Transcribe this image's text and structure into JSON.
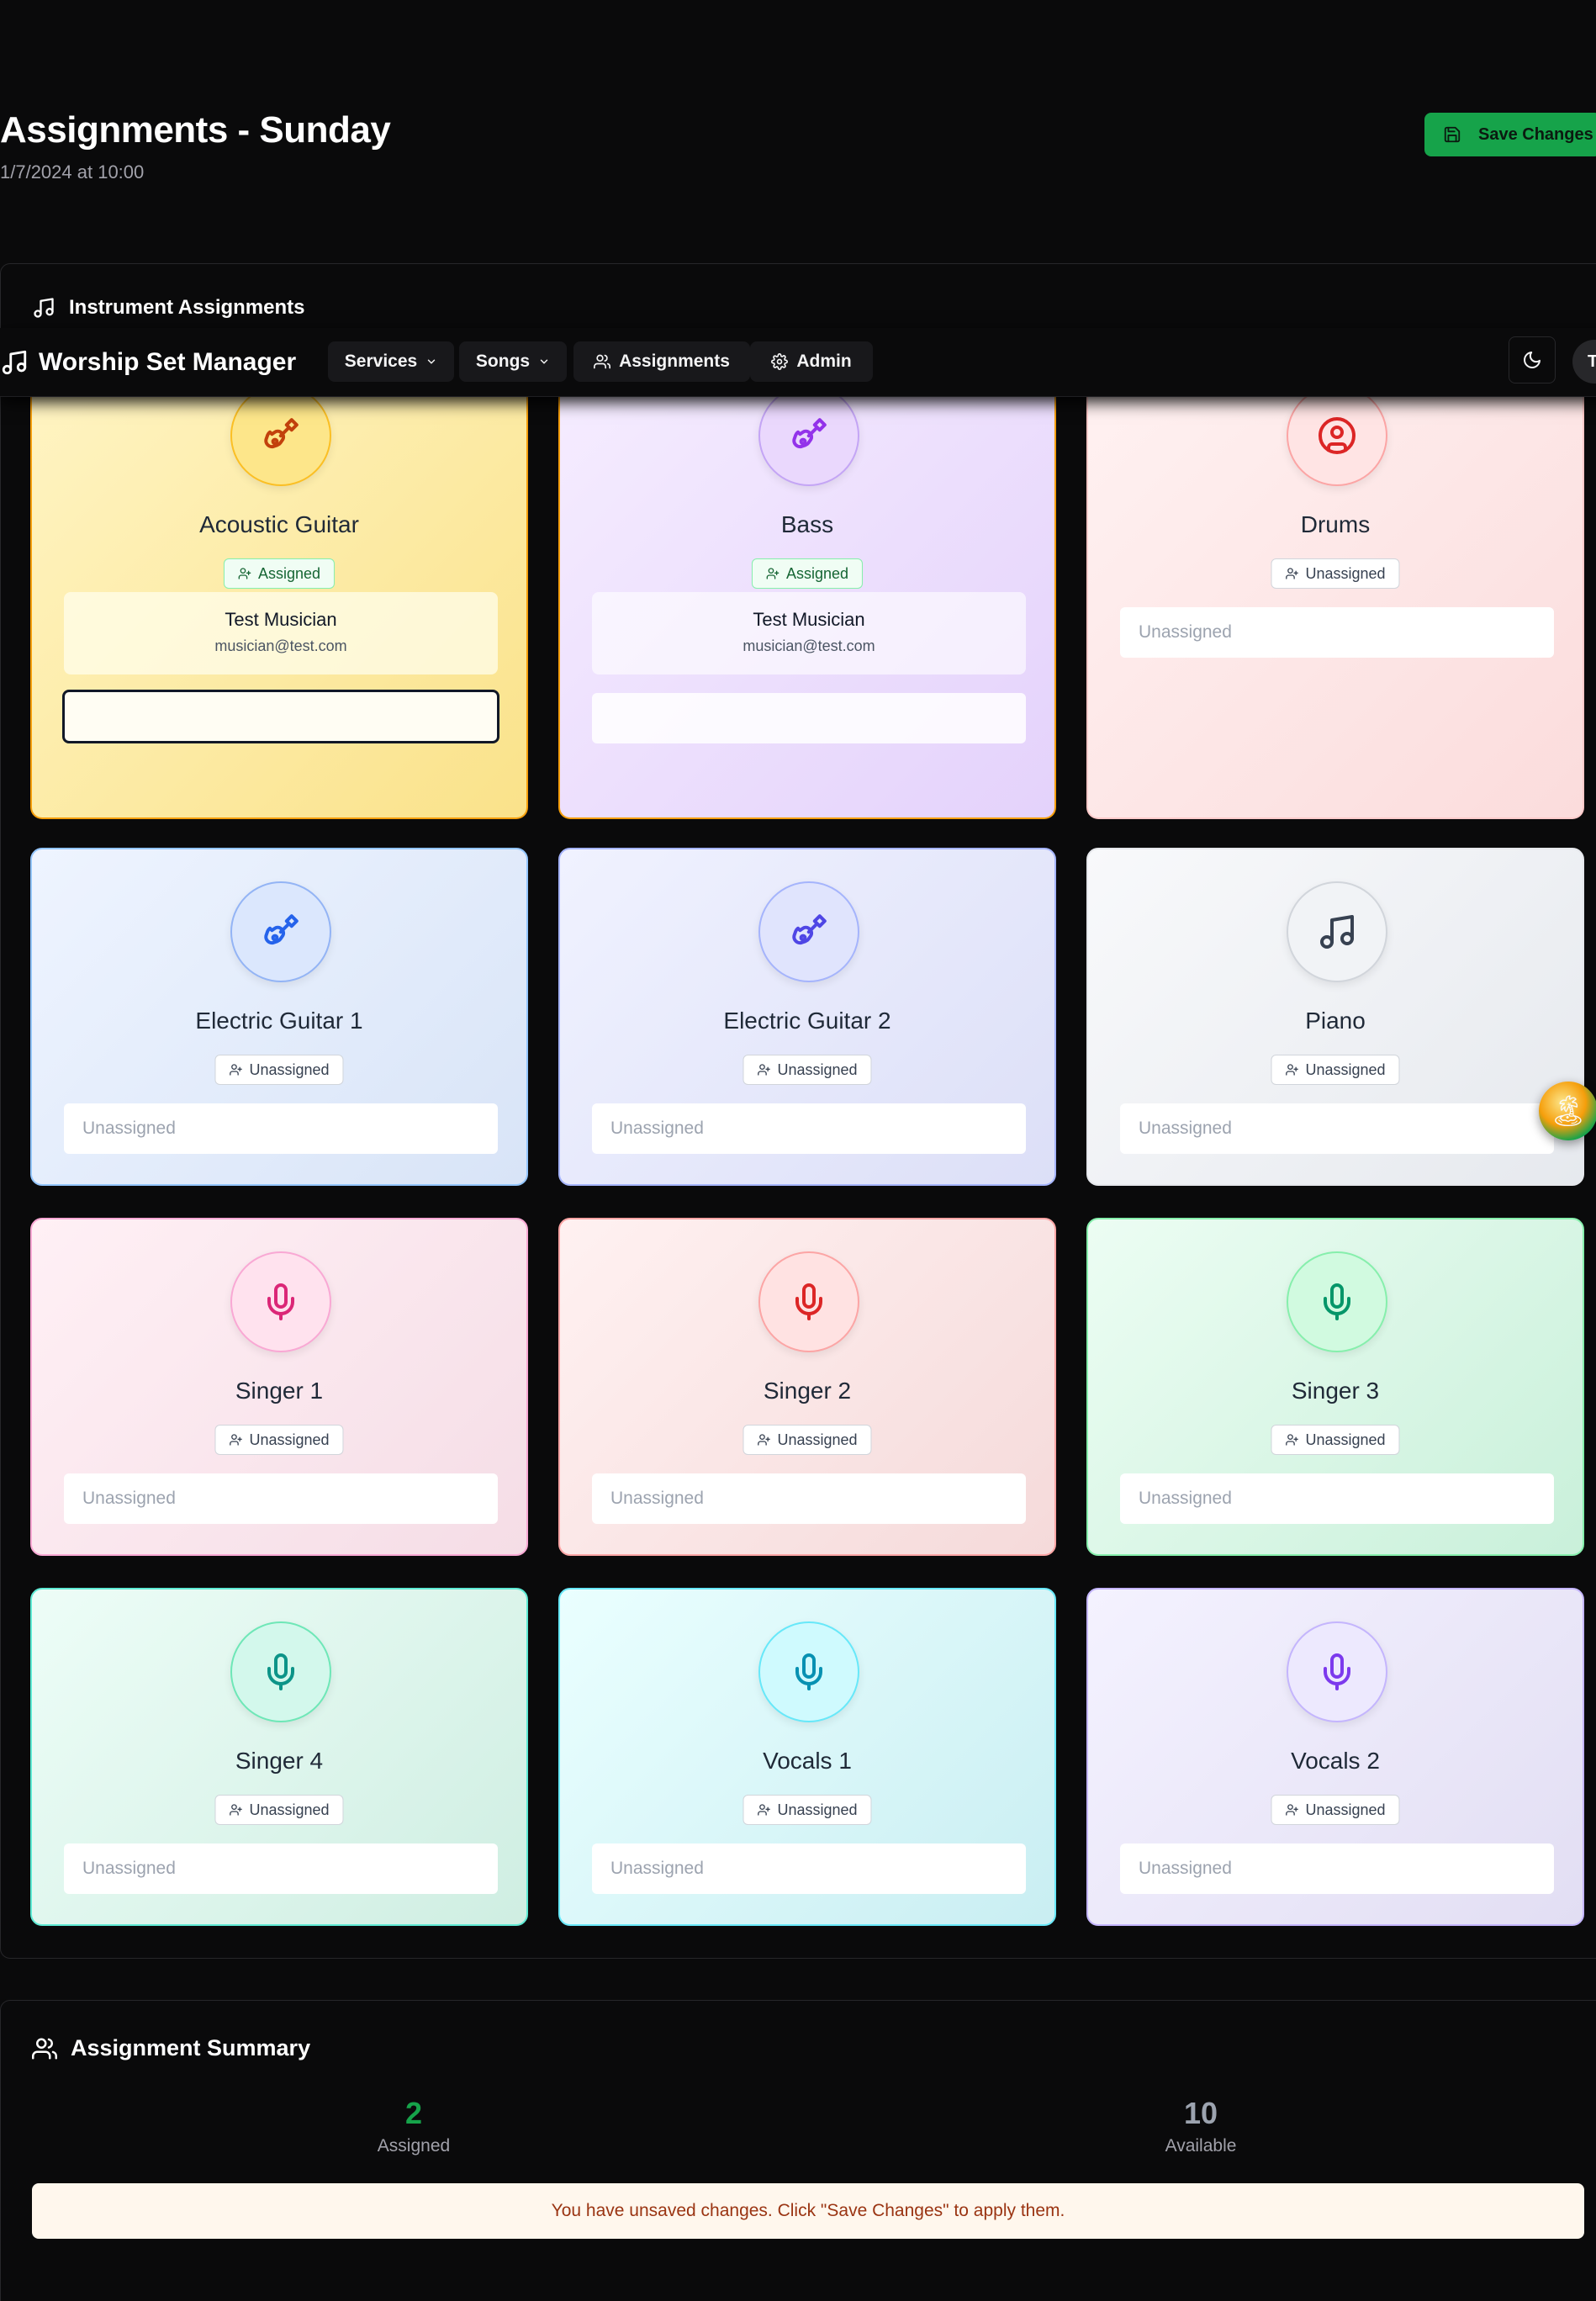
{
  "header": {
    "title": "Assignments - Sunday",
    "subtitle": "1/7/2024 at 10:00",
    "save_label": "Save Changes"
  },
  "navbar": {
    "brand": "Worship Set Manager",
    "items": [
      {
        "label": "Services",
        "icon": "chevron-down-icon"
      },
      {
        "label": "Songs",
        "icon": "chevron-down-icon"
      },
      {
        "label": "Assignments",
        "icon": "users-icon"
      },
      {
        "label": "Admin",
        "icon": "gear-icon"
      }
    ],
    "theme_icon": "moon-icon",
    "user_initial": "T"
  },
  "instrument_section": {
    "title": "Instrument Assignments"
  },
  "instruments": [
    {
      "name": "Acoustic Guitar",
      "icon": "guitar-icon",
      "status": "Assigned",
      "musician": "Test Musician",
      "email": "musician@test.com",
      "select_placeholder": "",
      "bg_from": "#fff4c2",
      "bg_to": "#fae28a",
      "border": "#f59e0b",
      "circle_bg": "#fde68a",
      "circle_border": "#fbbf24",
      "icon_color": "#c2410c"
    },
    {
      "name": "Bass",
      "icon": "guitar-icon",
      "status": "Assigned",
      "musician": "Test Musician",
      "email": "musician@test.com",
      "select_placeholder": "",
      "bg_from": "#f5ecff",
      "bg_to": "#e4d2fb",
      "border": "#f59e0b",
      "circle_bg": "#ead8fd",
      "circle_border": "#c4a5f5",
      "icon_color": "#9333ea"
    },
    {
      "name": "Drums",
      "icon": "drum-icon",
      "status": "Unassigned",
      "musician": "",
      "email": "",
      "select_placeholder": "Unassigned",
      "bg_from": "#fff1f1",
      "bg_to": "#fbdcdc",
      "border": "#fecaca",
      "circle_bg": "#ffe4e4",
      "circle_border": "#fca5a5",
      "icon_color": "#dc2626"
    },
    {
      "name": "Electric Guitar 1",
      "icon": "guitar-icon",
      "status": "Unassigned",
      "musician": "",
      "email": "",
      "select_placeholder": "Unassigned",
      "bg_from": "#eef4ff",
      "bg_to": "#d8e4f7",
      "border": "#93c5fd",
      "circle_bg": "#dbe7fd",
      "circle_border": "#93b4f5",
      "icon_color": "#2563eb"
    },
    {
      "name": "Electric Guitar 2",
      "icon": "guitar-icon",
      "status": "Unassigned",
      "musician": "",
      "email": "",
      "select_placeholder": "Unassigned",
      "bg_from": "#f0f2ff",
      "bg_to": "#dcdff7",
      "border": "#a5b4fc",
      "circle_bg": "#e0e4fd",
      "circle_border": "#a5b4fc",
      "icon_color": "#4f46e5"
    },
    {
      "name": "Piano",
      "icon": "music-note-icon",
      "status": "Unassigned",
      "musician": "",
      "email": "",
      "select_placeholder": "Unassigned",
      "bg_from": "#f8f9fb",
      "bg_to": "#e6e9ee",
      "border": "#e5e7eb",
      "circle_bg": "#f1f3f6",
      "circle_border": "#d1d5db",
      "icon_color": "#374151"
    },
    {
      "name": "Singer 1",
      "icon": "microphone-icon",
      "status": "Unassigned",
      "musician": "",
      "email": "",
      "select_placeholder": "Unassigned",
      "bg_from": "#fff0f5",
      "bg_to": "#f5dde6",
      "border": "#f9a8d4",
      "circle_bg": "#ffe2ee",
      "circle_border": "#f9a8d4",
      "icon_color": "#db2777"
    },
    {
      "name": "Singer 2",
      "icon": "microphone-icon",
      "status": "Unassigned",
      "musician": "",
      "email": "",
      "select_placeholder": "Unassigned",
      "bg_from": "#fff1f1",
      "bg_to": "#f5dada",
      "border": "#fca5a5",
      "circle_bg": "#ffe2e2",
      "circle_border": "#fca5a5",
      "icon_color": "#dc2626"
    },
    {
      "name": "Singer 3",
      "icon": "microphone-icon",
      "status": "Unassigned",
      "musician": "",
      "email": "",
      "select_placeholder": "Unassigned",
      "bg_from": "#ecfdf3",
      "bg_to": "#c9f0da",
      "border": "#86efac",
      "circle_bg": "#d1fae0",
      "circle_border": "#86efac",
      "icon_color": "#059669"
    },
    {
      "name": "Singer 4",
      "icon": "microphone-icon",
      "status": "Unassigned",
      "musician": "",
      "email": "",
      "select_placeholder": "Unassigned",
      "bg_from": "#edfdf7",
      "bg_to": "#cfeee2",
      "border": "#5eead4",
      "circle_bg": "#d3f8ec",
      "circle_border": "#6ee7b7",
      "icon_color": "#0d9488"
    },
    {
      "name": "Vocals 1",
      "icon": "microphone-icon",
      "status": "Unassigned",
      "musician": "",
      "email": "",
      "select_placeholder": "Unassigned",
      "bg_from": "#eaffff",
      "bg_to": "#c9eef2",
      "border": "#67e8f9",
      "circle_bg": "#cffafe",
      "circle_border": "#67e8f9",
      "icon_color": "#0891b2"
    },
    {
      "name": "Vocals 2",
      "icon": "microphone-icon",
      "status": "Unassigned",
      "musician": "",
      "email": "",
      "select_placeholder": "Unassigned",
      "bg_from": "#f4f2ff",
      "bg_to": "#e2def3",
      "border": "#c4b5fd",
      "circle_bg": "#ede9fe",
      "circle_border": "#c4b5fd",
      "icon_color": "#7c3aed"
    }
  ],
  "summary": {
    "title": "Assignment Summary",
    "assigned_count": "2",
    "assigned_label": "Assigned",
    "available_count": "10",
    "available_label": "Available",
    "notice": "You have unsaved changes. Click \"Save Changes\" to apply them.",
    "assigned_color": "#16a34a",
    "available_color": "#9ca3af"
  }
}
